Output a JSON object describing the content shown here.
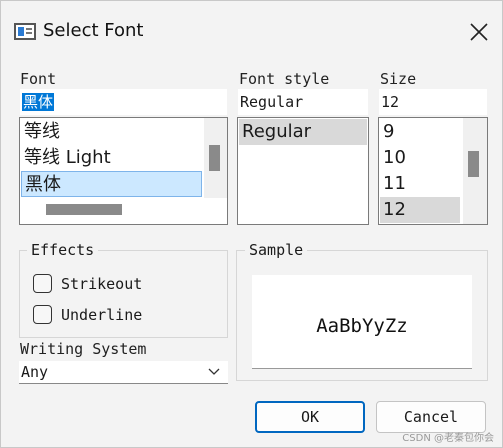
{
  "window": {
    "title": "Select Font"
  },
  "font": {
    "label": "Font",
    "value": "黑体",
    "items": [
      "等线",
      "等线 Light",
      "黑体"
    ],
    "selected_index": 2
  },
  "font_style": {
    "label": "Font style",
    "value": "Regular",
    "items": [
      "Regular"
    ],
    "selected_index": 0
  },
  "size": {
    "label": "Size",
    "value": "12",
    "items": [
      "9",
      "10",
      "11",
      "12"
    ],
    "selected_index": 3
  },
  "effects": {
    "title": "Effects",
    "strikeout": {
      "label": "Strikeout",
      "checked": false
    },
    "underline": {
      "label": "Underline",
      "checked": false
    }
  },
  "sample": {
    "title": "Sample",
    "text": "AaBbYyZz"
  },
  "writing_system": {
    "label": "Writing System",
    "value": "Any"
  },
  "buttons": {
    "ok": "OK",
    "cancel": "Cancel"
  },
  "watermark": "CSDN @老秦包你会",
  "colors": {
    "selection_blue": "#0078d7",
    "list_highlight": "#cce8ff",
    "default_button_border": "#0067c0"
  }
}
